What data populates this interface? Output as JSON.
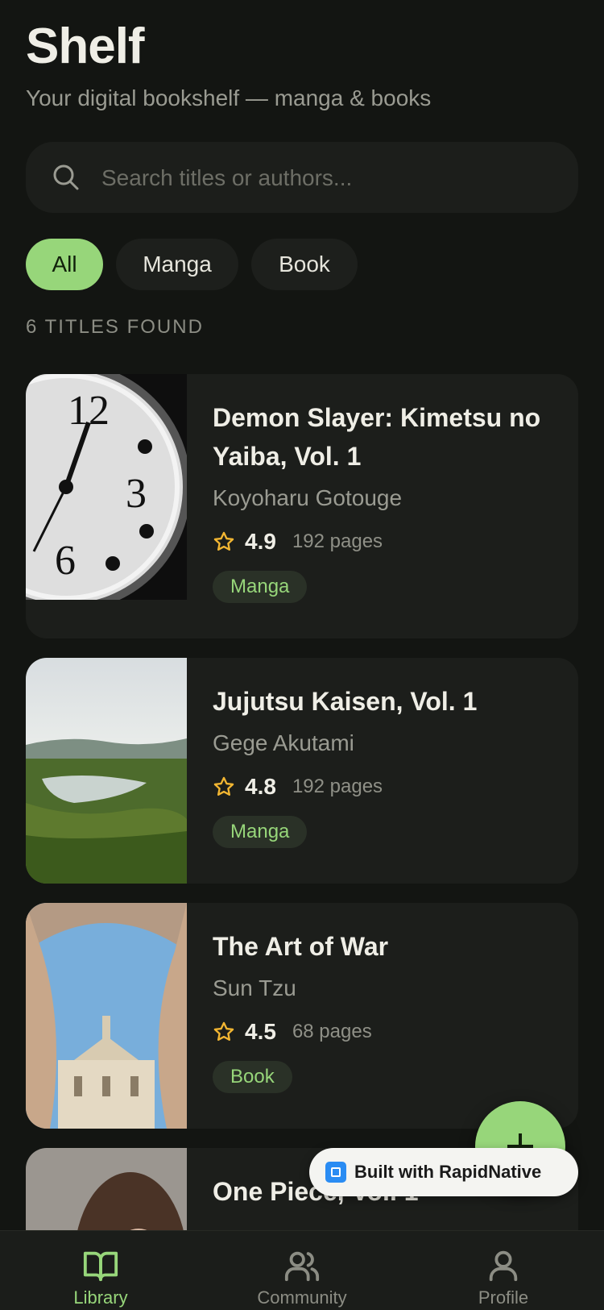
{
  "header": {
    "title": "Shelf",
    "subtitle": "Your digital bookshelf — manga & books"
  },
  "search": {
    "placeholder": "Search titles or authors...",
    "value": ""
  },
  "filters": [
    {
      "label": "All",
      "active": true
    },
    {
      "label": "Manga",
      "active": false
    },
    {
      "label": "Book",
      "active": false
    }
  ],
  "results_count": "6 TITLES FOUND",
  "books": [
    {
      "title": "Demon Slayer: Kimetsu no Yaiba, Vol. 1",
      "author": "Koyoharu Gotouge",
      "rating": "4.9",
      "pages": "192 pages",
      "tag": "Manga",
      "cover": "clock-face-photo"
    },
    {
      "title": "Jujutsu Kaisen, Vol. 1",
      "author": "Gege Akutami",
      "rating": "4.8",
      "pages": "192 pages",
      "tag": "Manga",
      "cover": "forest-lake-photo"
    },
    {
      "title": "The Art of War",
      "author": "Sun Tzu",
      "rating": "4.5",
      "pages": "68 pages",
      "tag": "Book",
      "cover": "baroque-building-photo"
    },
    {
      "title": "One Piece, Vol. 1",
      "cover": "portrait-photo"
    }
  ],
  "fab": {
    "icon": "plus-icon"
  },
  "badge": {
    "text": "Built with RapidNative"
  },
  "tabbar": [
    {
      "label": "Library",
      "icon": "book-open-icon",
      "active": true
    },
    {
      "label": "Community",
      "icon": "users-icon",
      "active": false
    },
    {
      "label": "Profile",
      "icon": "user-icon",
      "active": false
    }
  ],
  "colors": {
    "background": "#131512",
    "card": "#1c1e1b",
    "accent": "#97d67a",
    "star": "#f2b632",
    "muted_text": "#9a9b92"
  }
}
